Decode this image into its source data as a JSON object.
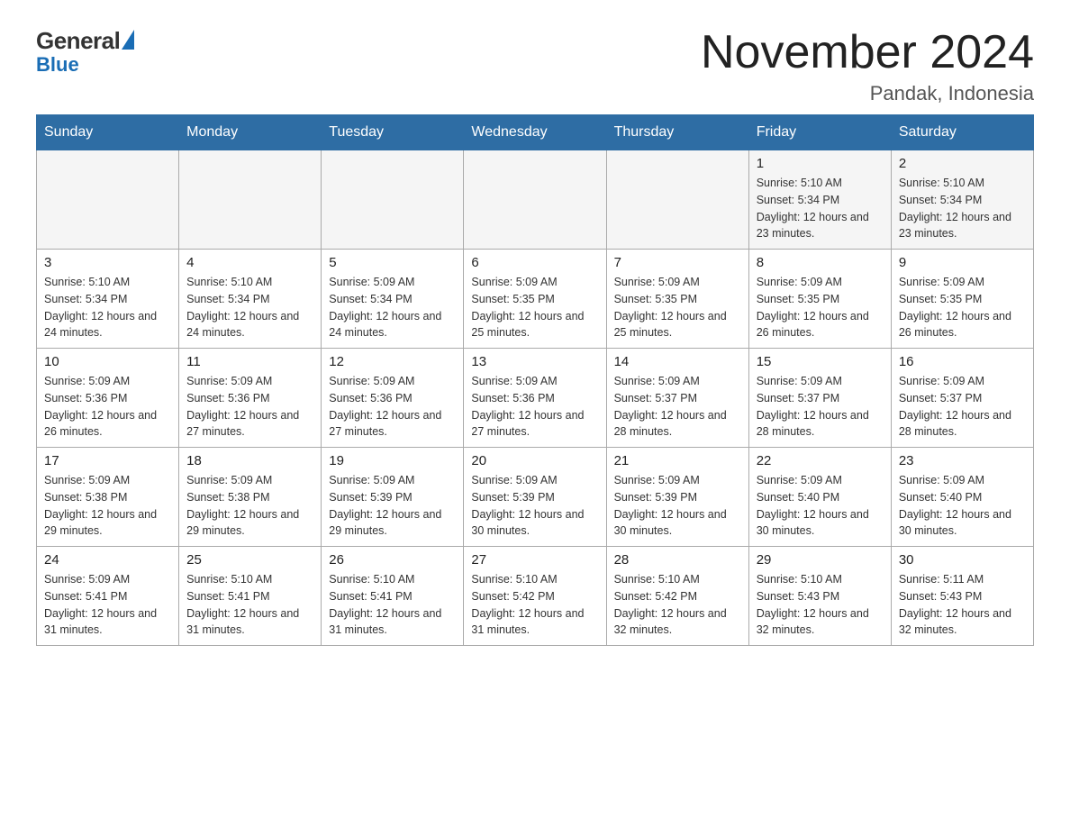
{
  "logo": {
    "general": "General",
    "blue": "Blue"
  },
  "title": {
    "month_year": "November 2024",
    "location": "Pandak, Indonesia"
  },
  "weekdays": [
    "Sunday",
    "Monday",
    "Tuesday",
    "Wednesday",
    "Thursday",
    "Friday",
    "Saturday"
  ],
  "weeks": [
    [
      {
        "day": "",
        "info": ""
      },
      {
        "day": "",
        "info": ""
      },
      {
        "day": "",
        "info": ""
      },
      {
        "day": "",
        "info": ""
      },
      {
        "day": "",
        "info": ""
      },
      {
        "day": "1",
        "info": "Sunrise: 5:10 AM\nSunset: 5:34 PM\nDaylight: 12 hours and 23 minutes."
      },
      {
        "day": "2",
        "info": "Sunrise: 5:10 AM\nSunset: 5:34 PM\nDaylight: 12 hours and 23 minutes."
      }
    ],
    [
      {
        "day": "3",
        "info": "Sunrise: 5:10 AM\nSunset: 5:34 PM\nDaylight: 12 hours and 24 minutes."
      },
      {
        "day": "4",
        "info": "Sunrise: 5:10 AM\nSunset: 5:34 PM\nDaylight: 12 hours and 24 minutes."
      },
      {
        "day": "5",
        "info": "Sunrise: 5:09 AM\nSunset: 5:34 PM\nDaylight: 12 hours and 24 minutes."
      },
      {
        "day": "6",
        "info": "Sunrise: 5:09 AM\nSunset: 5:35 PM\nDaylight: 12 hours and 25 minutes."
      },
      {
        "day": "7",
        "info": "Sunrise: 5:09 AM\nSunset: 5:35 PM\nDaylight: 12 hours and 25 minutes."
      },
      {
        "day": "8",
        "info": "Sunrise: 5:09 AM\nSunset: 5:35 PM\nDaylight: 12 hours and 26 minutes."
      },
      {
        "day": "9",
        "info": "Sunrise: 5:09 AM\nSunset: 5:35 PM\nDaylight: 12 hours and 26 minutes."
      }
    ],
    [
      {
        "day": "10",
        "info": "Sunrise: 5:09 AM\nSunset: 5:36 PM\nDaylight: 12 hours and 26 minutes."
      },
      {
        "day": "11",
        "info": "Sunrise: 5:09 AM\nSunset: 5:36 PM\nDaylight: 12 hours and 27 minutes."
      },
      {
        "day": "12",
        "info": "Sunrise: 5:09 AM\nSunset: 5:36 PM\nDaylight: 12 hours and 27 minutes."
      },
      {
        "day": "13",
        "info": "Sunrise: 5:09 AM\nSunset: 5:36 PM\nDaylight: 12 hours and 27 minutes."
      },
      {
        "day": "14",
        "info": "Sunrise: 5:09 AM\nSunset: 5:37 PM\nDaylight: 12 hours and 28 minutes."
      },
      {
        "day": "15",
        "info": "Sunrise: 5:09 AM\nSunset: 5:37 PM\nDaylight: 12 hours and 28 minutes."
      },
      {
        "day": "16",
        "info": "Sunrise: 5:09 AM\nSunset: 5:37 PM\nDaylight: 12 hours and 28 minutes."
      }
    ],
    [
      {
        "day": "17",
        "info": "Sunrise: 5:09 AM\nSunset: 5:38 PM\nDaylight: 12 hours and 29 minutes."
      },
      {
        "day": "18",
        "info": "Sunrise: 5:09 AM\nSunset: 5:38 PM\nDaylight: 12 hours and 29 minutes."
      },
      {
        "day": "19",
        "info": "Sunrise: 5:09 AM\nSunset: 5:39 PM\nDaylight: 12 hours and 29 minutes."
      },
      {
        "day": "20",
        "info": "Sunrise: 5:09 AM\nSunset: 5:39 PM\nDaylight: 12 hours and 30 minutes."
      },
      {
        "day": "21",
        "info": "Sunrise: 5:09 AM\nSunset: 5:39 PM\nDaylight: 12 hours and 30 minutes."
      },
      {
        "day": "22",
        "info": "Sunrise: 5:09 AM\nSunset: 5:40 PM\nDaylight: 12 hours and 30 minutes."
      },
      {
        "day": "23",
        "info": "Sunrise: 5:09 AM\nSunset: 5:40 PM\nDaylight: 12 hours and 30 minutes."
      }
    ],
    [
      {
        "day": "24",
        "info": "Sunrise: 5:09 AM\nSunset: 5:41 PM\nDaylight: 12 hours and 31 minutes."
      },
      {
        "day": "25",
        "info": "Sunrise: 5:10 AM\nSunset: 5:41 PM\nDaylight: 12 hours and 31 minutes."
      },
      {
        "day": "26",
        "info": "Sunrise: 5:10 AM\nSunset: 5:41 PM\nDaylight: 12 hours and 31 minutes."
      },
      {
        "day": "27",
        "info": "Sunrise: 5:10 AM\nSunset: 5:42 PM\nDaylight: 12 hours and 31 minutes."
      },
      {
        "day": "28",
        "info": "Sunrise: 5:10 AM\nSunset: 5:42 PM\nDaylight: 12 hours and 32 minutes."
      },
      {
        "day": "29",
        "info": "Sunrise: 5:10 AM\nSunset: 5:43 PM\nDaylight: 12 hours and 32 minutes."
      },
      {
        "day": "30",
        "info": "Sunrise: 5:11 AM\nSunset: 5:43 PM\nDaylight: 12 hours and 32 minutes."
      }
    ]
  ]
}
